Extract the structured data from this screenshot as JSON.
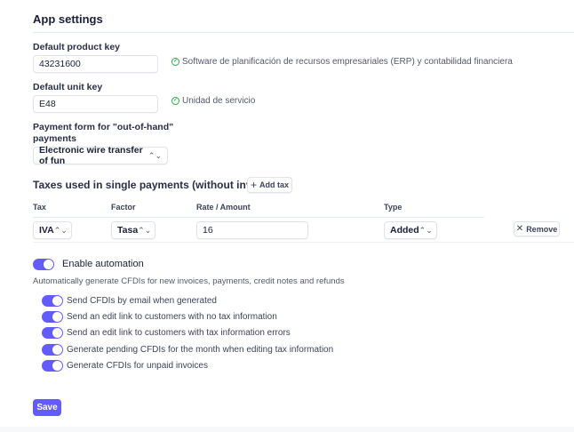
{
  "title": "App settings",
  "product_key": {
    "label": "Default product key",
    "value": "43231600",
    "status": "Software de planificación de recursos empresariales (ERP) y contabilidad financiera"
  },
  "unit_key": {
    "label": "Default unit key",
    "value": "E48",
    "status": "Unidad de servicio"
  },
  "payment_form": {
    "label_line1": "Payment form for \"out-of-hand\"",
    "label_line2": "payments",
    "value": "Electronic wire transfer of fun"
  },
  "taxes": {
    "heading": "Taxes used in single payments (without invoice)",
    "add_label": "Add tax",
    "columns": [
      "Tax",
      "Factor",
      "Rate / Amount",
      "Type"
    ],
    "row": {
      "tax": "IVA",
      "factor": "Tasa",
      "rate": "16",
      "type": "Added",
      "remove_label": "Remove"
    }
  },
  "automation": {
    "label": "Enable automation",
    "enabled": true,
    "description": "Automatically generate CFDIs for new invoices, payments, credit notes and refunds",
    "options": [
      {
        "label": "Send CFDIs by email when generated",
        "enabled": true
      },
      {
        "label": "Send an edit link to customers with no tax information",
        "enabled": true
      },
      {
        "label": "Send an edit link to customers with tax information errors",
        "enabled": true
      },
      {
        "label": "Generate pending CFDIs for the month when editing tax information",
        "enabled": true
      },
      {
        "label": "Generate CFDIs for unpaid invoices",
        "enabled": true
      }
    ]
  },
  "save_label": "Save",
  "colors": {
    "accent": "#635bff",
    "success": "#2eaa4b"
  }
}
